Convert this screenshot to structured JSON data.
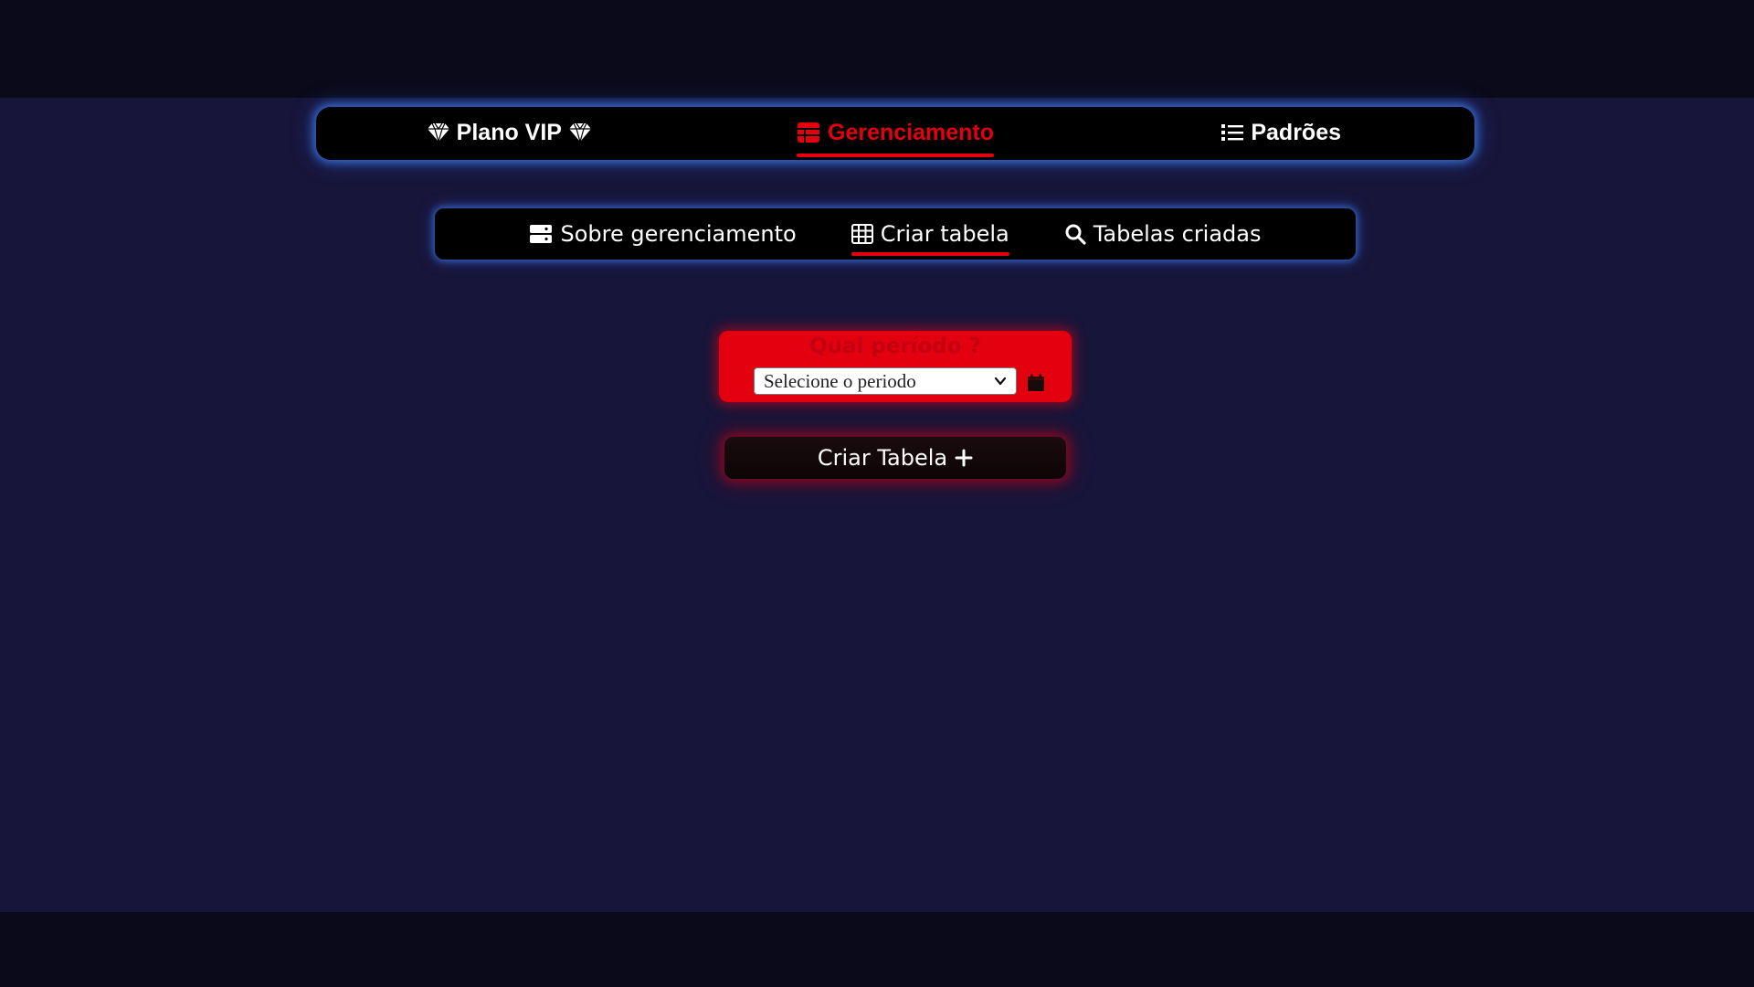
{
  "main_nav": {
    "items": [
      {
        "label": "Plano VIP",
        "icon": "diamond-icon",
        "active": false
      },
      {
        "label": "Gerenciamento",
        "icon": "table-icon",
        "active": true
      },
      {
        "label": "Padrões",
        "icon": "list-icon",
        "active": false
      }
    ]
  },
  "sub_nav": {
    "items": [
      {
        "label": "Sobre gerenciamento",
        "icon": "server-icon",
        "active": false
      },
      {
        "label": "Criar tabela",
        "icon": "grid-icon",
        "active": true
      },
      {
        "label": "Tabelas criadas",
        "icon": "search-icon",
        "active": false
      }
    ]
  },
  "period": {
    "label": "Qual período ?",
    "select_value": "Selecione o periodo"
  },
  "create_button": {
    "label": "Criar Tabela",
    "icon": "plus-icon"
  },
  "colors": {
    "accent_red": "#e3000f",
    "nav_glow_blue": "#3c78e6",
    "page_bg": "#18153a",
    "band_bg": "#0b0a1a"
  }
}
